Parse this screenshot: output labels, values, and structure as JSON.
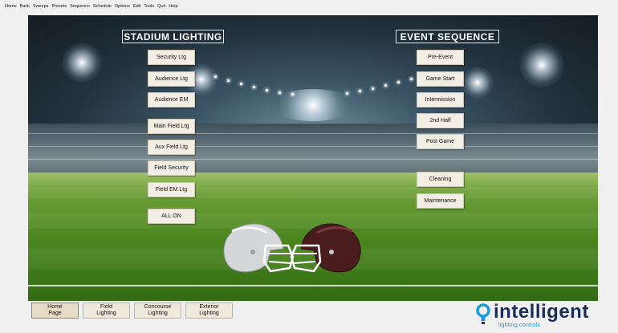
{
  "menu": [
    "Home",
    "Back",
    "Sweeps",
    "Presets",
    "Sequence",
    "Schedule",
    "Options",
    "Edit",
    "Tools",
    "Quit",
    "Help"
  ],
  "stadium_lighting": {
    "title": "STADIUM LIGHTING",
    "buttons": [
      "Security Ltg",
      "Audience Ltg",
      "Audience EM",
      "Main Field Ltg",
      "Aux Field Ltg",
      "Field Security",
      "Field EM Ltg",
      "ALL ON"
    ]
  },
  "event_sequence": {
    "title": "EVENT SEQUENCE",
    "buttons": [
      "Pre-Event",
      "Game Start",
      "Intermission",
      "2nd Half",
      "Post Game",
      "Cleaning",
      "Maintenance"
    ]
  },
  "tabs": [
    {
      "label": "Home\nPage",
      "active": true
    },
    {
      "label": "Field\nLighting",
      "active": false
    },
    {
      "label": "Concourse\nLighting",
      "active": false
    },
    {
      "label": "Exterior\nLighting",
      "active": false
    }
  ],
  "logo": {
    "word": "intelligent",
    "subtitle": "lighting controls",
    "brand_color": "#1b2d5a",
    "accent_color": "#1e9bd7"
  }
}
